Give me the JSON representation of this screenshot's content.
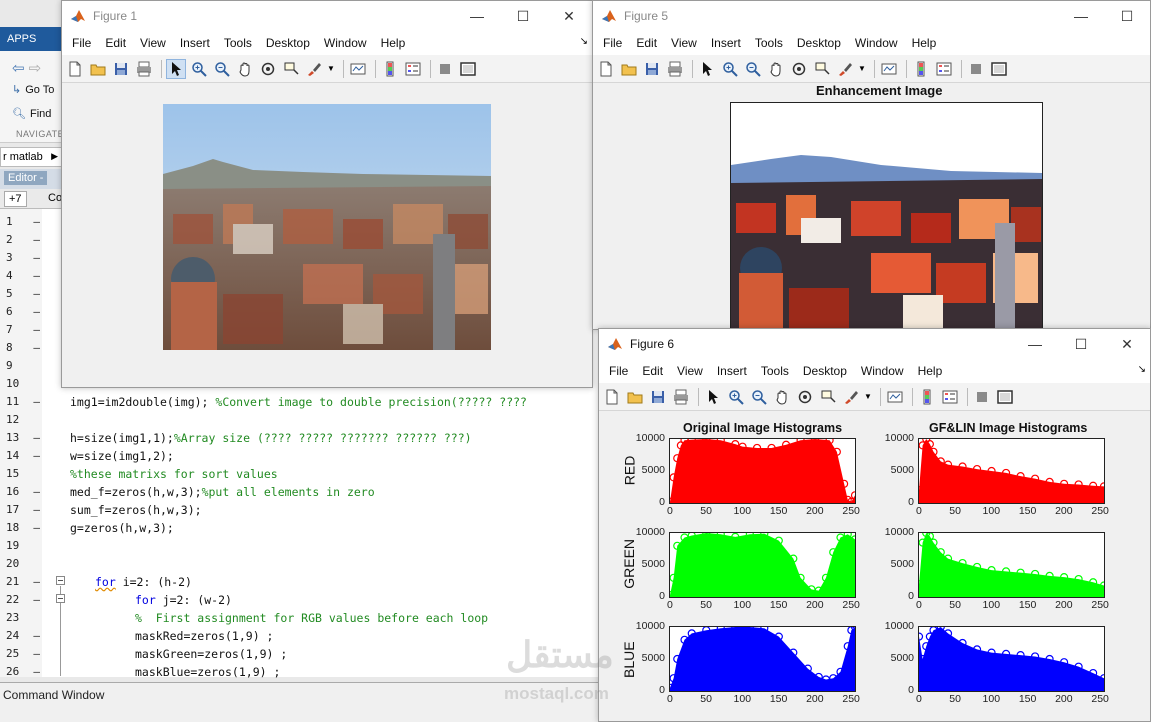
{
  "desktop": {
    "ribbon_tab": "APPS",
    "go_to": "Go To",
    "find": "Find",
    "navigate_section": "NAVIGATE",
    "path": "r matlab",
    "editor_title": "Editor -",
    "editor_tabs": [
      "+7",
      "Co"
    ],
    "line_numbers": [
      "1",
      "2",
      "3",
      "4",
      "5",
      "6",
      "7",
      "8",
      "9",
      "10",
      "11",
      "12",
      "13",
      "14",
      "15",
      "16",
      "17",
      "18",
      "19",
      "20",
      "21",
      "22",
      "23",
      "24",
      "25",
      "26"
    ],
    "code_lines": {
      "l11": "img1=im2double(img);",
      "l11c": " %Convert image to double precision(????? ????",
      "l13": "h=size(img1,1);",
      "l13c": "%Array size (???? ????? ??????? ?????? ???)",
      "l14": "w=size(img1,2);",
      "l15c": "%these matrixs for sort values",
      "l16": "med_f=zeros(h,w,3);",
      "l16c": "%put all elements in zero",
      "l17": "sum_f=zeros(h,w,3);",
      "l18": "g=zeros(h,w,3);",
      "l21k": "for",
      "l21": " i=2: (h-2)",
      "l22k": "for",
      "l22": " j=2: (w-2)",
      "l23c": "%  First assignment for RGB values before each loop",
      "l24": "maskRed=zeros(1,9) ;",
      "l25": "maskGreen=zeros(1,9) ;",
      "l26": "maskBlue=zeros(1,9) ;"
    },
    "command_window": "Command Window"
  },
  "menu_items": [
    "File",
    "Edit",
    "View",
    "Insert",
    "Tools",
    "Desktop",
    "Window",
    "Help"
  ],
  "figure1": {
    "title": "Figure 1"
  },
  "figure5": {
    "title": "Figure 5",
    "axes_title": "Enhancement Image"
  },
  "figure6": {
    "title": "Figure 6",
    "col_titles": [
      "Original Image Histograms",
      "GF&LIN Image Histograms"
    ],
    "row_labels": [
      "RED",
      "GREEN",
      "BLUE"
    ],
    "y_ticks": [
      "10000",
      "5000",
      "0"
    ],
    "x_ticks": [
      "0",
      "50",
      "100",
      "150",
      "200",
      "250"
    ]
  },
  "chart_data": [
    {
      "type": "scatter",
      "title": "Original Image Histograms",
      "ylabel": "RED",
      "xlim": [
        0,
        255
      ],
      "ylim": [
        0,
        10000
      ],
      "color": "#ff0000",
      "x": [
        0,
        5,
        10,
        15,
        20,
        30,
        50,
        70,
        90,
        100,
        120,
        140,
        160,
        180,
        200,
        220,
        230,
        240,
        245,
        250,
        255
      ],
      "y": [
        200,
        4000,
        7000,
        9000,
        9800,
        9900,
        10000,
        9800,
        9200,
        8800,
        8600,
        8600,
        9100,
        9800,
        10000,
        9800,
        8000,
        3000,
        500,
        200,
        1200
      ]
    },
    {
      "type": "scatter",
      "title": "GF&LIN Image Histograms",
      "ylabel": "RED",
      "xlim": [
        0,
        255
      ],
      "ylim": [
        0,
        10000
      ],
      "color": "#ff0000",
      "x": [
        0,
        5,
        10,
        15,
        20,
        30,
        40,
        60,
        80,
        100,
        120,
        140,
        160,
        180,
        200,
        220,
        240,
        255
      ],
      "y": [
        2000,
        9000,
        10000,
        9200,
        8000,
        6500,
        6000,
        5700,
        5300,
        5000,
        4700,
        4200,
        3800,
        3300,
        3000,
        2900,
        2700,
        2600
      ]
    },
    {
      "type": "scatter",
      "title": "",
      "ylabel": "GREEN",
      "xlim": [
        0,
        255
      ],
      "ylim": [
        0,
        10000
      ],
      "color": "#00ff00",
      "x": [
        0,
        5,
        10,
        20,
        30,
        50,
        70,
        90,
        110,
        130,
        150,
        170,
        180,
        195,
        205,
        215,
        225,
        235,
        245,
        255
      ],
      "y": [
        300,
        3000,
        8000,
        9300,
        9600,
        10000,
        9800,
        9400,
        9800,
        9900,
        8800,
        6000,
        3000,
        1200,
        1000,
        3000,
        7000,
        9300,
        9800,
        9000
      ]
    },
    {
      "type": "scatter",
      "title": "",
      "ylabel": "GREEN",
      "xlim": [
        0,
        255
      ],
      "ylim": [
        0,
        10000
      ],
      "color": "#00ff00",
      "x": [
        0,
        5,
        10,
        15,
        20,
        30,
        40,
        60,
        80,
        100,
        120,
        140,
        160,
        180,
        200,
        220,
        240,
        255
      ],
      "y": [
        2000,
        8500,
        10000,
        9500,
        8500,
        7000,
        6000,
        5300,
        4700,
        4200,
        4000,
        3800,
        3600,
        3300,
        3100,
        2800,
        2300,
        1800
      ]
    },
    {
      "type": "scatter",
      "title": "",
      "ylabel": "BLUE",
      "xlim": [
        0,
        255
      ],
      "ylim": [
        0,
        10000
      ],
      "color": "#0000ff",
      "x": [
        0,
        5,
        10,
        20,
        30,
        50,
        70,
        90,
        110,
        130,
        150,
        170,
        190,
        205,
        215,
        225,
        235,
        245,
        250,
        255
      ],
      "y": [
        500,
        2000,
        5000,
        8000,
        9000,
        9500,
        9800,
        10000,
        10000,
        9800,
        8500,
        6000,
        3500,
        2200,
        1800,
        2000,
        3000,
        7000,
        9500,
        10000
      ]
    },
    {
      "type": "scatter",
      "title": "",
      "ylabel": "BLUE",
      "xlim": [
        0,
        255
      ],
      "ylim": [
        0,
        10000
      ],
      "color": "#0000ff",
      "x": [
        0,
        5,
        10,
        15,
        20,
        30,
        40,
        60,
        80,
        100,
        120,
        140,
        160,
        180,
        200,
        220,
        240,
        255
      ],
      "y": [
        8500,
        5000,
        7000,
        8500,
        9500,
        10000,
        9000,
        7500,
        6500,
        6000,
        5800,
        5600,
        5400,
        5000,
        4500,
        3800,
        2800,
        2000
      ]
    }
  ],
  "watermark": {
    "arabic": "مستقل",
    "latin": "mostaql.com"
  },
  "icons": {
    "menu_toolbar": [
      "new-figure-icon",
      "open-file-icon",
      "save-icon",
      "print-icon",
      "pointer-icon",
      "zoom-in-icon",
      "zoom-out-icon",
      "pan-icon",
      "rotate-icon",
      "data-cursor-icon",
      "brush-icon",
      "link-plot-icon",
      "colorbar-icon",
      "legend-icon",
      "hide-plot-tools-icon",
      "show-plot-tools-icon"
    ]
  }
}
